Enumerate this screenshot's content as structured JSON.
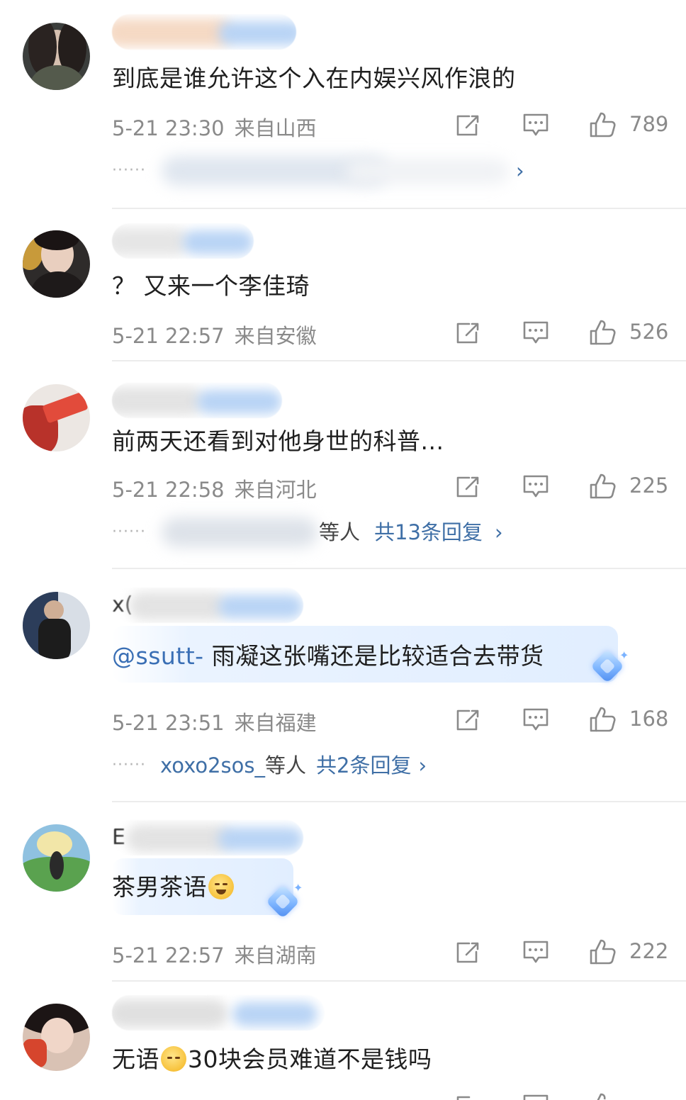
{
  "comments": [
    {
      "username_prefix": "",
      "text": "到底是谁允许这个入在内娱兴风作浪的",
      "time": "5-21 23:30",
      "location": "来自山西",
      "likes": "789",
      "reply": {
        "names": "",
        "others": "",
        "total": ""
      }
    },
    {
      "username_prefix": "",
      "text": "？ 又来一个李佳琦",
      "time": "5-21 22:57",
      "location": "来自安徽",
      "likes": "526"
    },
    {
      "username_prefix": "",
      "text": "前两天还看到对他身世的科普...",
      "time": "5-21 22:58",
      "location": "来自河北",
      "likes": "225",
      "reply": {
        "names": "",
        "others": "等人",
        "total": "共13条回复"
      }
    },
    {
      "username_prefix": "x(",
      "mention": "@ssutt-",
      "text": " 雨凝这张嘴还是比较适合去带货",
      "time": "5-21 23:51",
      "location": "来自福建",
      "likes": "168",
      "reply": {
        "names": "xoxo2sos_",
        "others": "等人",
        "total": "共2条回复"
      }
    },
    {
      "username_prefix": "E",
      "text": "茶男茶语",
      "time": "5-21 22:57",
      "location": "来自湖南",
      "likes": "222"
    },
    {
      "username_prefix": "",
      "text_a": "无语",
      "text_b": "30块会员难道不是钱吗"
    }
  ],
  "icons": {
    "repost": "repost-icon",
    "comment": "comment-icon",
    "like": "thumbs-up-icon"
  },
  "colors": {
    "link": "#3f6fa6",
    "meta": "#8a8a8a"
  }
}
